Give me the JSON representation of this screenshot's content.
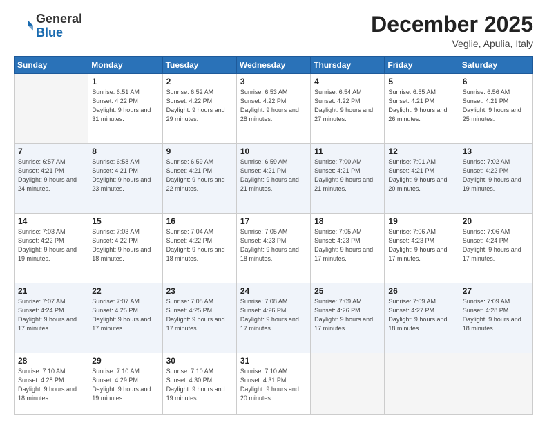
{
  "header": {
    "logo": {
      "general": "General",
      "blue": "Blue"
    },
    "title": "December 2025",
    "location": "Veglie, Apulia, Italy"
  },
  "weekdays": [
    "Sunday",
    "Monday",
    "Tuesday",
    "Wednesday",
    "Thursday",
    "Friday",
    "Saturday"
  ],
  "weeks": [
    [
      {
        "day": null
      },
      {
        "day": 1,
        "sunrise": "6:51 AM",
        "sunset": "4:22 PM",
        "daylight": "9 hours and 31 minutes."
      },
      {
        "day": 2,
        "sunrise": "6:52 AM",
        "sunset": "4:22 PM",
        "daylight": "9 hours and 29 minutes."
      },
      {
        "day": 3,
        "sunrise": "6:53 AM",
        "sunset": "4:22 PM",
        "daylight": "9 hours and 28 minutes."
      },
      {
        "day": 4,
        "sunrise": "6:54 AM",
        "sunset": "4:22 PM",
        "daylight": "9 hours and 27 minutes."
      },
      {
        "day": 5,
        "sunrise": "6:55 AM",
        "sunset": "4:21 PM",
        "daylight": "9 hours and 26 minutes."
      },
      {
        "day": 6,
        "sunrise": "6:56 AM",
        "sunset": "4:21 PM",
        "daylight": "9 hours and 25 minutes."
      }
    ],
    [
      {
        "day": 7,
        "sunrise": "6:57 AM",
        "sunset": "4:21 PM",
        "daylight": "9 hours and 24 minutes."
      },
      {
        "day": 8,
        "sunrise": "6:58 AM",
        "sunset": "4:21 PM",
        "daylight": "9 hours and 23 minutes."
      },
      {
        "day": 9,
        "sunrise": "6:59 AM",
        "sunset": "4:21 PM",
        "daylight": "9 hours and 22 minutes."
      },
      {
        "day": 10,
        "sunrise": "6:59 AM",
        "sunset": "4:21 PM",
        "daylight": "9 hours and 21 minutes."
      },
      {
        "day": 11,
        "sunrise": "7:00 AM",
        "sunset": "4:21 PM",
        "daylight": "9 hours and 21 minutes."
      },
      {
        "day": 12,
        "sunrise": "7:01 AM",
        "sunset": "4:21 PM",
        "daylight": "9 hours and 20 minutes."
      },
      {
        "day": 13,
        "sunrise": "7:02 AM",
        "sunset": "4:22 PM",
        "daylight": "9 hours and 19 minutes."
      }
    ],
    [
      {
        "day": 14,
        "sunrise": "7:03 AM",
        "sunset": "4:22 PM",
        "daylight": "9 hours and 19 minutes."
      },
      {
        "day": 15,
        "sunrise": "7:03 AM",
        "sunset": "4:22 PM",
        "daylight": "9 hours and 18 minutes."
      },
      {
        "day": 16,
        "sunrise": "7:04 AM",
        "sunset": "4:22 PM",
        "daylight": "9 hours and 18 minutes."
      },
      {
        "day": 17,
        "sunrise": "7:05 AM",
        "sunset": "4:23 PM",
        "daylight": "9 hours and 18 minutes."
      },
      {
        "day": 18,
        "sunrise": "7:05 AM",
        "sunset": "4:23 PM",
        "daylight": "9 hours and 17 minutes."
      },
      {
        "day": 19,
        "sunrise": "7:06 AM",
        "sunset": "4:23 PM",
        "daylight": "9 hours and 17 minutes."
      },
      {
        "day": 20,
        "sunrise": "7:06 AM",
        "sunset": "4:24 PM",
        "daylight": "9 hours and 17 minutes."
      }
    ],
    [
      {
        "day": 21,
        "sunrise": "7:07 AM",
        "sunset": "4:24 PM",
        "daylight": "9 hours and 17 minutes."
      },
      {
        "day": 22,
        "sunrise": "7:07 AM",
        "sunset": "4:25 PM",
        "daylight": "9 hours and 17 minutes."
      },
      {
        "day": 23,
        "sunrise": "7:08 AM",
        "sunset": "4:25 PM",
        "daylight": "9 hours and 17 minutes."
      },
      {
        "day": 24,
        "sunrise": "7:08 AM",
        "sunset": "4:26 PM",
        "daylight": "9 hours and 17 minutes."
      },
      {
        "day": 25,
        "sunrise": "7:09 AM",
        "sunset": "4:26 PM",
        "daylight": "9 hours and 17 minutes."
      },
      {
        "day": 26,
        "sunrise": "7:09 AM",
        "sunset": "4:27 PM",
        "daylight": "9 hours and 18 minutes."
      },
      {
        "day": 27,
        "sunrise": "7:09 AM",
        "sunset": "4:28 PM",
        "daylight": "9 hours and 18 minutes."
      }
    ],
    [
      {
        "day": 28,
        "sunrise": "7:10 AM",
        "sunset": "4:28 PM",
        "daylight": "9 hours and 18 minutes."
      },
      {
        "day": 29,
        "sunrise": "7:10 AM",
        "sunset": "4:29 PM",
        "daylight": "9 hours and 19 minutes."
      },
      {
        "day": 30,
        "sunrise": "7:10 AM",
        "sunset": "4:30 PM",
        "daylight": "9 hours and 19 minutes."
      },
      {
        "day": 31,
        "sunrise": "7:10 AM",
        "sunset": "4:31 PM",
        "daylight": "9 hours and 20 minutes."
      },
      {
        "day": null
      },
      {
        "day": null
      },
      {
        "day": null
      }
    ]
  ]
}
